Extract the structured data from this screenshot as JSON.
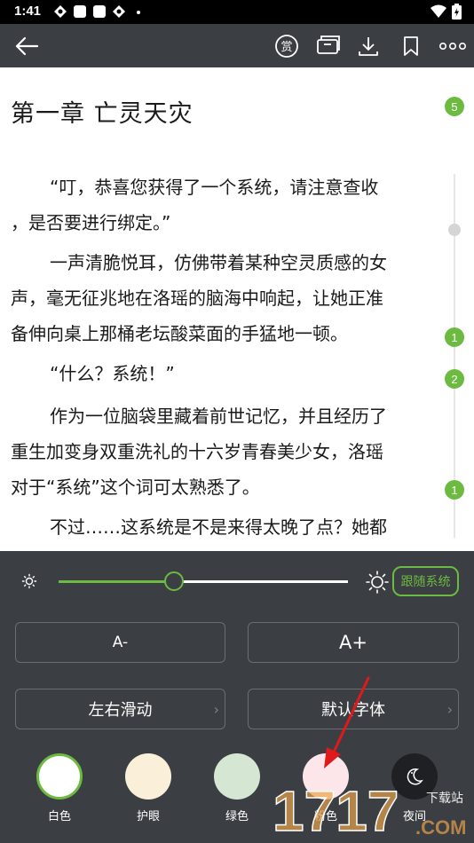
{
  "status_bar": {
    "time": "1:41"
  },
  "toolbar": {
    "icons": [
      "back-arrow-icon",
      "reward-icon",
      "screen-icon",
      "download-icon",
      "bookmark-icon",
      "more-icon"
    ],
    "reward_glyph": "赏"
  },
  "reader": {
    "chapter_title": "第一章 亡灵天灾",
    "paragraphs": [
      [
        "“叮，恭喜您获得了一个系统，请注意查收",
        "，是否要进行绑定。”"
      ],
      [
        "一声清脆悦耳，仿佛带着某种空灵质感的女",
        "声，毫无征兆地在洛瑶的脑海中响起，让她正准",
        "备伸向桌上那桶老坛酸菜面的手猛地一顿。"
      ],
      [
        "“什么？系统！”"
      ],
      [
        "作为一位脑袋里藏着前世记忆，并且经历了",
        "重生加变身双重洗礼的十六岁青春美少女，洛瑶",
        "对于“系统”这个词可太熟悉了。"
      ],
      [
        "不过……这系统是不是来得太晚了点？她都"
      ]
    ],
    "comment_markers": [
      "5",
      "1",
      "2",
      "1"
    ]
  },
  "settings": {
    "brightness_percent": 40,
    "follow_system_label": "跟随系统",
    "font_smaller_label": "A-",
    "font_larger_label": "A+",
    "page_mode_label": "左右滑动",
    "font_label": "默认字体",
    "themes": [
      {
        "label": "白色",
        "color": "#ffffff",
        "selected": true
      },
      {
        "label": "护眼",
        "color": "#faefd9",
        "selected": false
      },
      {
        "label": "绿色",
        "color": "#d5e6d3",
        "selected": false
      },
      {
        "label": "粉色",
        "color": "#fde6ea",
        "selected": false
      },
      {
        "label": "夜间",
        "color": "#1f2023",
        "selected": false
      }
    ]
  },
  "colors": {
    "accent": "#6cba3f",
    "panel_bg": "#3b3e43"
  },
  "watermark": {
    "text": "1717",
    "suffix": "下载站",
    "domain": ".COM"
  }
}
